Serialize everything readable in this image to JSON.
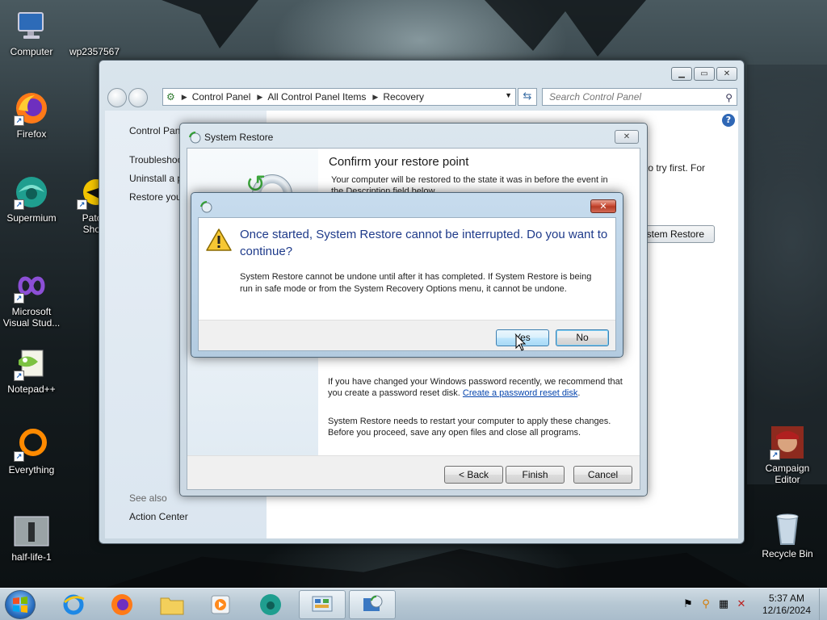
{
  "desktop": {
    "icons": [
      {
        "label": "Computer"
      },
      {
        "label": "wp2357567"
      },
      {
        "label": "Firefox"
      },
      {
        "label": "Supermium"
      },
      {
        "label": "Patch Short"
      },
      {
        "label": "Microsoft Visual Stud..."
      },
      {
        "label": "Notepad++"
      },
      {
        "label": "Everything"
      },
      {
        "label": "half-life-1"
      },
      {
        "label": "Campaign Editor"
      },
      {
        "label": "Recycle Bin"
      }
    ]
  },
  "control_panel": {
    "breadcrumb": [
      "Control Panel",
      "All Control Panel Items",
      "Recovery"
    ],
    "search_placeholder": "Search Control Panel",
    "left_links": [
      "Control Pan",
      "Troubleshoo",
      "Uninstall a p",
      "Restore you"
    ],
    "see_also": "See also",
    "action_center": "Action Center",
    "right_text": "to try first. For",
    "open_system_restore": "ystem Restore",
    "help": "?"
  },
  "system_restore": {
    "title": "System Restore",
    "heading": "Confirm your restore point",
    "intro": "Your computer will be restored to the state it was in before the event in the Description field below.",
    "password_note_pre": "If you have changed your Windows password recently, we recommend that you create a password reset disk. ",
    "password_link": "Create a password reset disk",
    "password_note_post": ".",
    "restart_note": "System Restore needs to restart your computer to apply these changes. Before you proceed, save any open files and close all programs.",
    "buttons": {
      "back": "< Back",
      "finish": "Finish",
      "cancel": "Cancel"
    }
  },
  "confirm_dialog": {
    "main_instruction": "Once started, System Restore cannot be interrupted. Do you want to continue?",
    "content": "System Restore cannot be undone until after it has completed. If System Restore is being run in safe mode or from the System Recovery Options menu, it cannot be undone.",
    "yes": "Yes",
    "no": "No"
  },
  "taskbar": {
    "clock_time": "5:37 AM",
    "clock_date": "12/16/2024"
  },
  "colors": {
    "instruction_blue": "#1e3a8a",
    "link_blue": "#0645ad",
    "close_red": "#c6432c"
  }
}
